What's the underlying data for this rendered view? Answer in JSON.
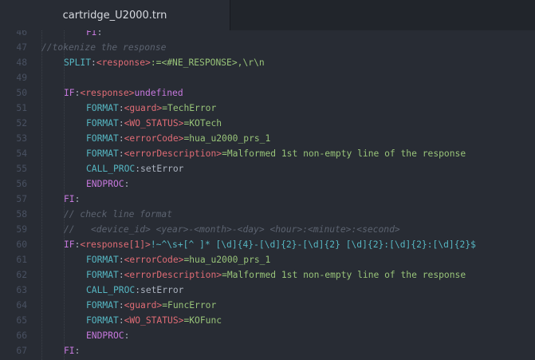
{
  "tab": {
    "filename": "cartridge_U2000.trn"
  },
  "lines": [
    {
      "num": "46",
      "indent": 2,
      "tokens": [
        {
          "t": "FI",
          "c": "kw"
        },
        {
          "t": ":",
          "c": "plain"
        }
      ]
    },
    {
      "num": "47",
      "indent": 0,
      "tokens": [
        {
          "t": "//tokenize the response",
          "c": "cmt"
        }
      ]
    },
    {
      "num": "48",
      "indent": 1,
      "tokens": [
        {
          "t": "SPLIT",
          "c": "cmd"
        },
        {
          "t": ":",
          "c": "plain"
        },
        {
          "t": "<response>",
          "c": "var"
        },
        {
          "t": ":=<#NE_RESPONSE>,\\r\\n",
          "c": "str"
        }
      ]
    },
    {
      "num": "49",
      "indent": 0,
      "tokens": []
    },
    {
      "num": "50",
      "indent": 1,
      "tokens": [
        {
          "t": "IF",
          "c": "kw"
        },
        {
          "t": ":",
          "c": "plain"
        },
        {
          "t": "<response>",
          "c": "var"
        },
        {
          "t": "undefined",
          "c": "kw"
        }
      ]
    },
    {
      "num": "51",
      "indent": 2,
      "tokens": [
        {
          "t": "FORMAT",
          "c": "cmd"
        },
        {
          "t": ":",
          "c": "plain"
        },
        {
          "t": "<guard>",
          "c": "var"
        },
        {
          "t": "=TechError",
          "c": "str"
        }
      ]
    },
    {
      "num": "52",
      "indent": 2,
      "tokens": [
        {
          "t": "FORMAT",
          "c": "cmd"
        },
        {
          "t": ":",
          "c": "plain"
        },
        {
          "t": "<WO_STATUS>",
          "c": "var"
        },
        {
          "t": "=KOTech",
          "c": "str"
        }
      ]
    },
    {
      "num": "53",
      "indent": 2,
      "tokens": [
        {
          "t": "FORMAT",
          "c": "cmd"
        },
        {
          "t": ":",
          "c": "plain"
        },
        {
          "t": "<errorCode>",
          "c": "var"
        },
        {
          "t": "=hua_u2000_prs_1",
          "c": "str"
        }
      ]
    },
    {
      "num": "54",
      "indent": 2,
      "tokens": [
        {
          "t": "FORMAT",
          "c": "cmd"
        },
        {
          "t": ":",
          "c": "plain"
        },
        {
          "t": "<errorDescription>",
          "c": "var"
        },
        {
          "t": "=Malformed 1st non-empty line of the response",
          "c": "str"
        }
      ]
    },
    {
      "num": "55",
      "indent": 2,
      "tokens": [
        {
          "t": "CALL_PROC",
          "c": "cmd"
        },
        {
          "t": ":setError",
          "c": "plain"
        }
      ]
    },
    {
      "num": "56",
      "indent": 2,
      "tokens": [
        {
          "t": "ENDPROC",
          "c": "kw"
        },
        {
          "t": ":",
          "c": "plain"
        }
      ]
    },
    {
      "num": "57",
      "indent": 1,
      "tokens": [
        {
          "t": "FI",
          "c": "kw"
        },
        {
          "t": ":",
          "c": "plain"
        }
      ]
    },
    {
      "num": "58",
      "indent": 1,
      "tokens": [
        {
          "t": "// check line format",
          "c": "cmt"
        }
      ]
    },
    {
      "num": "59",
      "indent": 1,
      "tokens": [
        {
          "t": "//   <device_id> <year>-<month>-<day> <hour>:<minute>:<second>",
          "c": "cmt"
        }
      ]
    },
    {
      "num": "60",
      "indent": 1,
      "tokens": [
        {
          "t": "IF",
          "c": "kw"
        },
        {
          "t": ":",
          "c": "plain"
        },
        {
          "t": "<response[1]>",
          "c": "var"
        },
        {
          "t": "!~^\\s+[^ ]* [\\d]{4}-[\\d]{2}-[\\d]{2} [\\d]{2}:[\\d]{2}:[\\d]{2}$",
          "c": "regex"
        }
      ]
    },
    {
      "num": "61",
      "indent": 2,
      "tokens": [
        {
          "t": "FORMAT",
          "c": "cmd"
        },
        {
          "t": ":",
          "c": "plain"
        },
        {
          "t": "<errorCode>",
          "c": "var"
        },
        {
          "t": "=hua_u2000_prs_1",
          "c": "str"
        }
      ]
    },
    {
      "num": "62",
      "indent": 2,
      "tokens": [
        {
          "t": "FORMAT",
          "c": "cmd"
        },
        {
          "t": ":",
          "c": "plain"
        },
        {
          "t": "<errorDescription>",
          "c": "var"
        },
        {
          "t": "=Malformed 1st non-empty line of the response",
          "c": "str"
        }
      ]
    },
    {
      "num": "63",
      "indent": 2,
      "tokens": [
        {
          "t": "CALL_PROC",
          "c": "cmd"
        },
        {
          "t": ":setError",
          "c": "plain"
        }
      ]
    },
    {
      "num": "64",
      "indent": 2,
      "tokens": [
        {
          "t": "FORMAT",
          "c": "cmd"
        },
        {
          "t": ":",
          "c": "plain"
        },
        {
          "t": "<guard>",
          "c": "var"
        },
        {
          "t": "=FuncError",
          "c": "str"
        }
      ]
    },
    {
      "num": "65",
      "indent": 2,
      "tokens": [
        {
          "t": "FORMAT",
          "c": "cmd"
        },
        {
          "t": ":",
          "c": "plain"
        },
        {
          "t": "<WO_STATUS>",
          "c": "var"
        },
        {
          "t": "=KOFunc",
          "c": "str"
        }
      ]
    },
    {
      "num": "66",
      "indent": 2,
      "tokens": [
        {
          "t": "ENDPROC",
          "c": "kw"
        },
        {
          "t": ":",
          "c": "plain"
        }
      ]
    },
    {
      "num": "67",
      "indent": 1,
      "tokens": [
        {
          "t": "FI",
          "c": "kw"
        },
        {
          "t": ":",
          "c": "plain"
        }
      ]
    }
  ]
}
